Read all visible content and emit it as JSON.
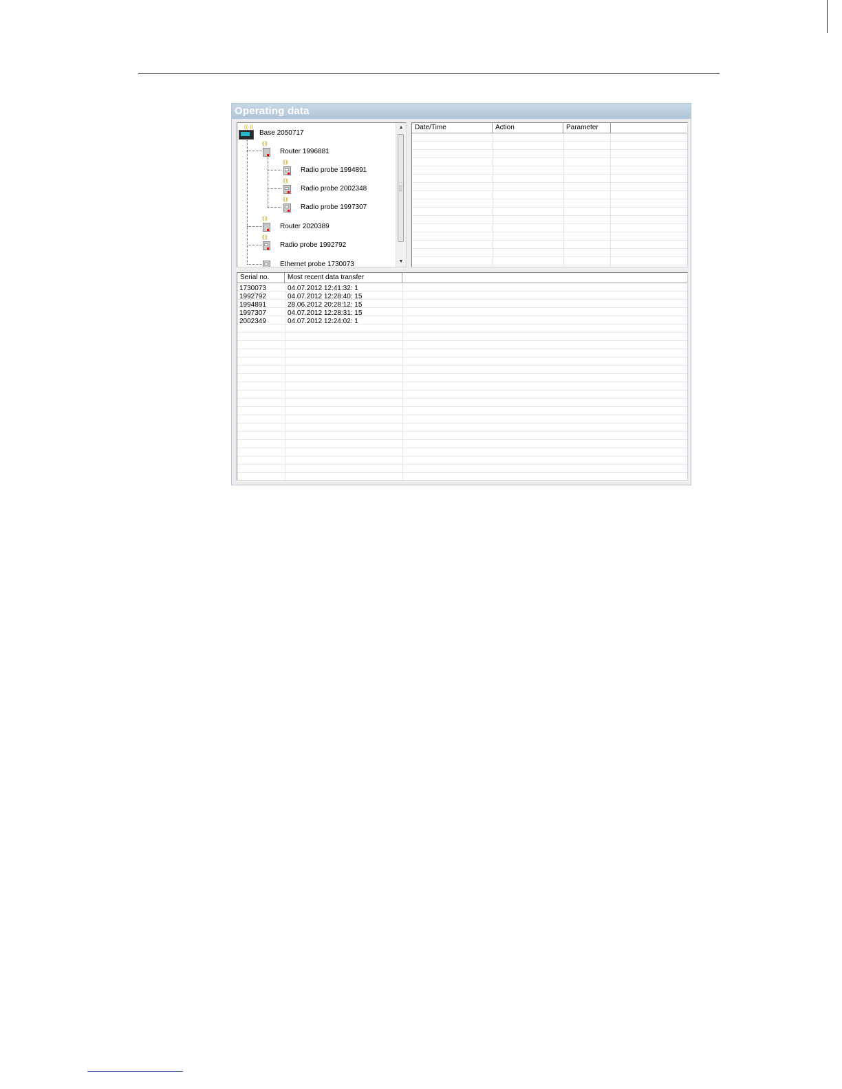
{
  "window": {
    "title": "Operating data"
  },
  "tree": {
    "nodes": [
      {
        "label": "Base 2050717",
        "type": "base-icon"
      },
      {
        "label": "Router 1996881",
        "type": "router-icon"
      },
      {
        "label": "Radio probe 1994891",
        "type": "radio-probe-icon"
      },
      {
        "label": "Radio probe 2002348",
        "type": "radio-probe-icon"
      },
      {
        "label": "Radio probe 1997307",
        "type": "radio-probe-icon"
      },
      {
        "label": "Router 2020389",
        "type": "router-icon"
      },
      {
        "label": "Radio probe 1992792",
        "type": "radio-probe-icon"
      },
      {
        "label": "Ethernet probe 1730073",
        "type": "ethernet-probe-icon"
      }
    ]
  },
  "log_table": {
    "columns": [
      "Date/Time",
      "Action",
      "Parameter"
    ],
    "rows": []
  },
  "serial_table": {
    "columns": [
      "Serial no.",
      "Most recent data transfer"
    ],
    "rows": [
      {
        "serial": "1730073",
        "transfer": "04.07.2012 12:41:32: 1"
      },
      {
        "serial": "1992792",
        "transfer": "04.07.2012 12:28:40: 15"
      },
      {
        "serial": "1994891",
        "transfer": "28.06.2012 20:28:12: 15"
      },
      {
        "serial": "1997307",
        "transfer": "04.07.2012 12:28:31: 15"
      },
      {
        "serial": "2002349",
        "transfer": "04.07.2012 12:24:02: 1"
      }
    ]
  },
  "colors": {
    "titlebar": "#b8cbde",
    "title_text": "#ffffff",
    "led": "#dd1111",
    "antenna": "#c79a00"
  }
}
